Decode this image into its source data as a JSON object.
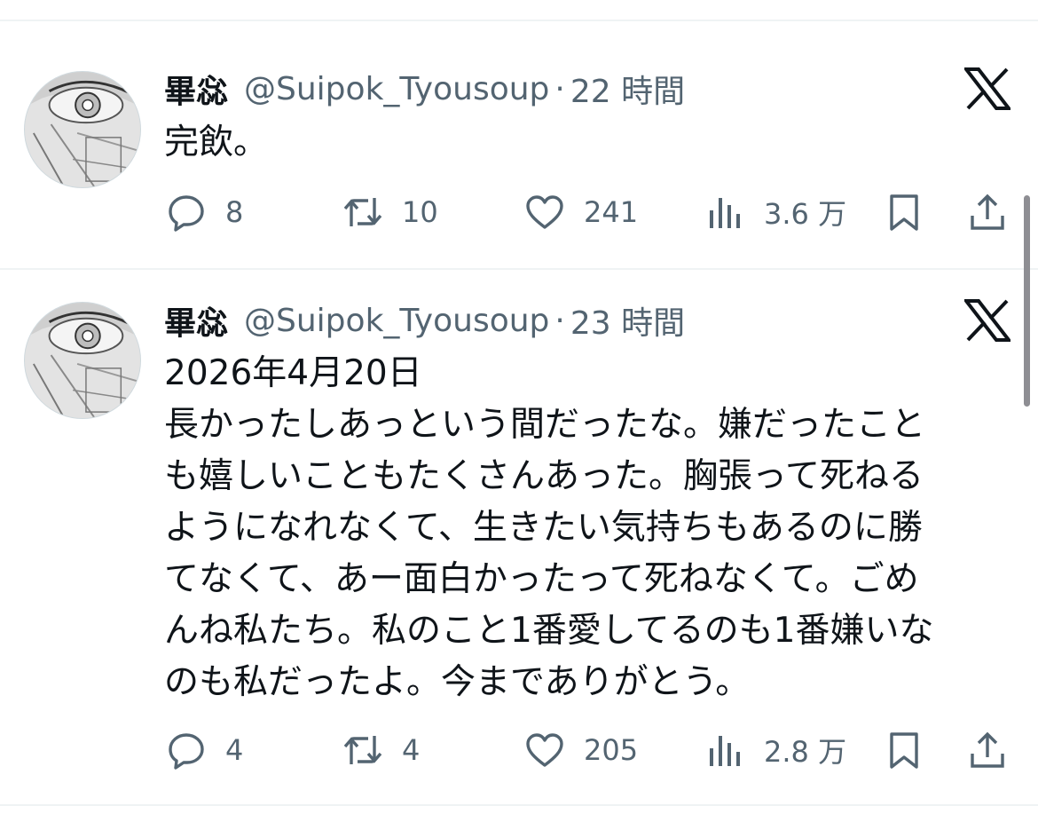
{
  "tweets": [
    {
      "display_name": "畢惢",
      "handle": "@Suipok_Tyousoup",
      "separator": "·",
      "time": "22 時間",
      "text": "完飲。",
      "counts": {
        "replies": "8",
        "retweets": "10",
        "likes": "241",
        "views": "3.6 万"
      }
    },
    {
      "display_name": "畢惢",
      "handle": "@Suipok_Tyousoup",
      "separator": "·",
      "time": "23 時間",
      "text": "2026年4月20日\n長かったしあっという間だったな。嫌だったこと\nも嬉しいこともたくさんあった。胸張って死ねる\nようになれなくて、生きたい気持ちもあるのに勝\nてなくて、あー面白かったって死ねなくて。ごめ\nんね私たち。私のこと1番愛してるのも1番嫌いな\nのも私だったよ。今までありがとう。",
      "counts": {
        "replies": "4",
        "retweets": "4",
        "likes": "205",
        "views": "2.8 万"
      }
    }
  ],
  "icons": {
    "reply": "speech-bubble-icon",
    "retweet": "retweet-arrows-icon",
    "like": "heart-icon",
    "views": "bar-chart-icon",
    "bookmark": "bookmark-icon",
    "share": "share-upload-icon",
    "brand": "x-logo-icon"
  },
  "colors": {
    "text_primary": "#0f1419",
    "text_secondary": "#536471",
    "divider": "#eff3f4",
    "background": "#ffffff"
  }
}
